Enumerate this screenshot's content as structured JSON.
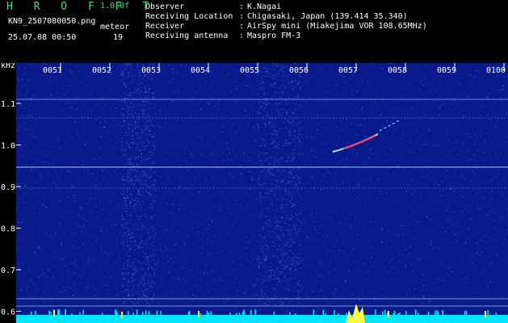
{
  "header": {
    "app_name": "H R O F F T",
    "version": "1.0.0f",
    "filename": "KN9_2507080050.png",
    "datetime": "25.07.08 00:50",
    "mode": "meteor",
    "count": "19"
  },
  "info": [
    {
      "key": "Observer",
      "value": "K.Nagai"
    },
    {
      "key": "Receiving Location",
      "value": "Chigasaki, Japan (139.414 35.340)"
    },
    {
      "key": "Receiver",
      "value": "AirSpy mini (Miakejima VOR 108.65MHz)"
    },
    {
      "key": "Receiving antenna",
      "value": "Maspro FM-3"
    }
  ],
  "spectrogram": {
    "y_unit": "kHz",
    "y_ticks": [
      "1.1",
      "1.0",
      "0.9",
      "0.8",
      "0.7",
      "0.6"
    ],
    "time_ticks": [
      "0051",
      "0052",
      "0053",
      "0054",
      "0055",
      "0056",
      "0057",
      "0058",
      "0059",
      "0100"
    ],
    "colors": {
      "background": "#0a1a8a",
      "noise": "#3a5cff",
      "signal": "#b0f0ff",
      "meteor": "#ff4060",
      "baseline": "#00e5ff",
      "peak": "#ffff40"
    }
  }
}
